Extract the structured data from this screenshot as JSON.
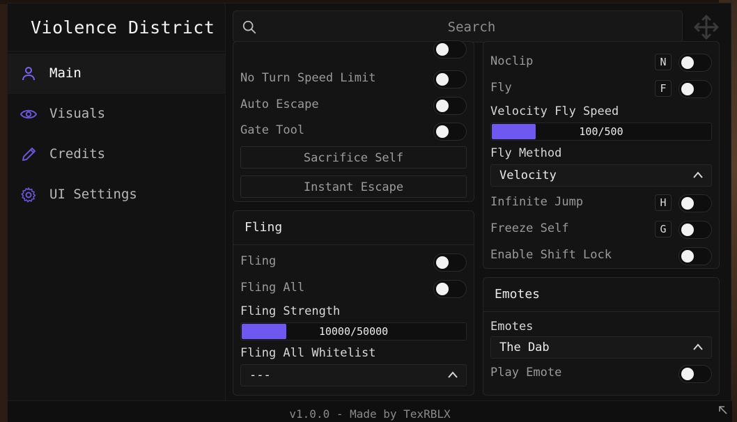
{
  "app": {
    "title": "Violence District"
  },
  "sidebar": {
    "items": [
      {
        "label": "Main",
        "icon": "user-icon",
        "active": true
      },
      {
        "label": "Visuals",
        "icon": "eye-icon",
        "active": false
      },
      {
        "label": "Credits",
        "icon": "pencil-icon",
        "active": false
      },
      {
        "label": "UI Settings",
        "icon": "gear-icon",
        "active": false
      }
    ]
  },
  "search": {
    "placeholder": "Search"
  },
  "left_column": {
    "main_panel": {
      "toggles": [
        {
          "label": "No Turn Speed Limit"
        },
        {
          "label": "Auto Escape"
        },
        {
          "label": "Gate Tool"
        }
      ],
      "buttons": [
        {
          "label": "Sacrifice Self"
        },
        {
          "label": "Instant Escape"
        }
      ]
    },
    "fling_panel": {
      "title": "Fling",
      "toggles": [
        {
          "label": "Fling"
        },
        {
          "label": "Fling All"
        }
      ],
      "slider": {
        "label": "Fling Strength",
        "value": 10000,
        "max": 50000,
        "display": "10000/50000",
        "fraction": 0.2
      },
      "dropdown": {
        "label": "Fling All Whitelist",
        "value": "---"
      }
    }
  },
  "right_column": {
    "movement_panel": {
      "toggles": [
        {
          "label": "Noclip",
          "key": "N"
        },
        {
          "label": "Fly",
          "key": "F"
        }
      ],
      "slider": {
        "label": "Velocity Fly Speed",
        "value": 100,
        "max": 500,
        "display": "100/500",
        "fraction": 0.2
      },
      "dropdown": {
        "label": "Fly Method",
        "value": "Velocity"
      },
      "toggles2": [
        {
          "label": "Infinite Jump",
          "key": "H"
        },
        {
          "label": "Freeze Self",
          "key": "G"
        },
        {
          "label": "Enable Shift Lock"
        }
      ]
    },
    "emotes_panel": {
      "title": "Emotes",
      "dropdown": {
        "label": "Emotes",
        "value": "The Dab"
      },
      "toggle": {
        "label": "Play Emote"
      }
    }
  },
  "footer": {
    "text": "v1.0.0 - Made by TexRBLX"
  },
  "colors": {
    "accent": "#6f58f0",
    "background": "#111111",
    "panel": "#141414"
  }
}
